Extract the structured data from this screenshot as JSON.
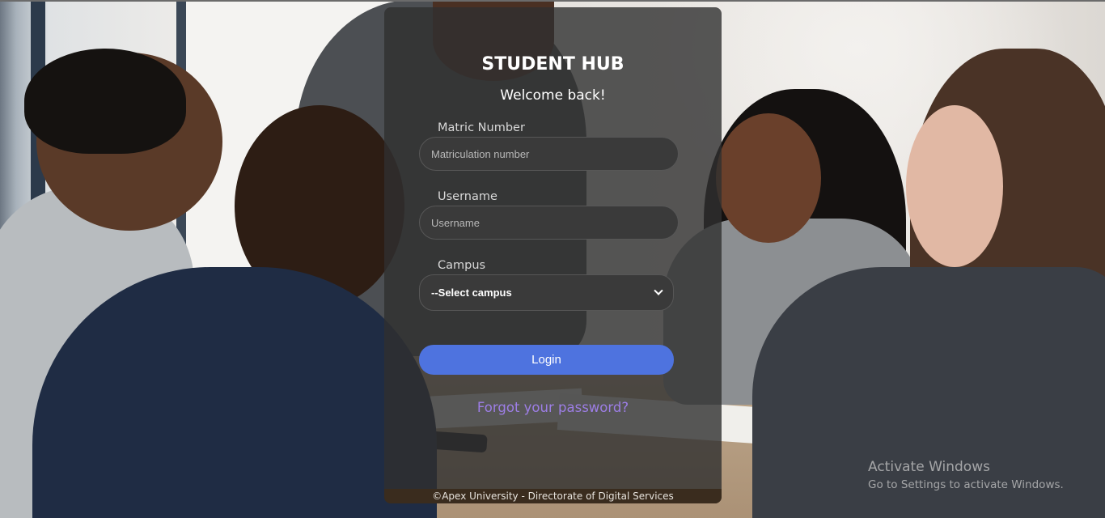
{
  "login": {
    "title": "STUDENT HUB",
    "subtitle": "Welcome back!",
    "matric": {
      "label": "Matric Number",
      "placeholder": "Matriculation number",
      "value": ""
    },
    "username": {
      "label": "Username",
      "placeholder": "Username",
      "value": ""
    },
    "campus": {
      "label": "Campus",
      "selected": "--Select campus"
    },
    "login_button": "Login",
    "forgot_link": "Forgot your password?",
    "footer": "©Apex University - Directorate of Digital Services"
  },
  "watermark": {
    "line1": "Activate Windows",
    "line2": "Go to Settings to activate Windows."
  },
  "colors": {
    "card_bg": "#303030",
    "accent_button": "#4e73df",
    "link": "#9d7ee6",
    "footer_bg": "#3a2c1e"
  }
}
